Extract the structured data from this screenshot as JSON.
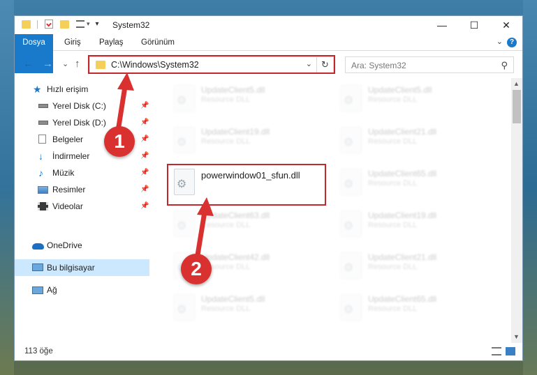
{
  "window": {
    "title": "System32",
    "minimize_glyph": "—",
    "maximize_glyph": "☐",
    "close_glyph": "✕"
  },
  "ribbon": {
    "tabs": [
      "Dosya",
      "Giriş",
      "Paylaş",
      "Görünüm"
    ],
    "help_glyph": "?",
    "collapse_glyph": "⌄"
  },
  "nav": {
    "back_glyph": "←",
    "forward_glyph": "→",
    "recent_glyph": "⌄",
    "up_glyph": "↑",
    "address": "C:\\Windows\\System32",
    "address_dropdown_glyph": "⌄",
    "refresh_glyph": "↻",
    "search_placeholder": "Ara: System32",
    "search_glyph": "⚲"
  },
  "sidebar": {
    "quick_access": "Hızlı erişim",
    "items": [
      {
        "label": "Yerel Disk (C:)",
        "icon": "drive-icon",
        "pinned": true
      },
      {
        "label": "Yerel Disk (D:)",
        "icon": "drive-icon",
        "pinned": true
      },
      {
        "label": "Belgeler",
        "icon": "documents-icon",
        "pinned": true
      },
      {
        "label": "İndirmeler",
        "icon": "downloads-icon",
        "pinned": true
      },
      {
        "label": "Müzik",
        "icon": "music-icon",
        "pinned": true
      },
      {
        "label": "Resimler",
        "icon": "pictures-icon",
        "pinned": true
      },
      {
        "label": "Videolar",
        "icon": "videos-icon",
        "pinned": true
      }
    ],
    "onedrive": "OneDrive",
    "this_pc": "Bu bilgisayar",
    "network": "Ağ",
    "pin_glyph": "📌"
  },
  "files": {
    "left_column": [
      {
        "name": "UpdateClient5.dll",
        "type": "Resource DLL"
      },
      {
        "name": "UpdateClient19.dll",
        "type": "Resource DLL"
      },
      {
        "name": "powerwindow01_sfun.dll",
        "type": ""
      },
      {
        "name": "UpdateClient63.dll",
        "type": "Resource DLL"
      },
      {
        "name": "UpdateClient42.dll",
        "type": "Resource DLL"
      },
      {
        "name": "UpdateClient5.dll",
        "type": "Resource DLL"
      }
    ],
    "right_column": [
      {
        "name": "UpdateClient5.dll",
        "type": "Resource DLL"
      },
      {
        "name": "UpdateClient21.dll",
        "type": "Resource DLL"
      },
      {
        "name": "UpdateClient65.dll",
        "type": "Resource DLL"
      },
      {
        "name": "UpdateClient19.dll",
        "type": "Resource DLL"
      },
      {
        "name": "UpdateClient21.dll",
        "type": "Resource DLL"
      },
      {
        "name": "UpdateClient65.dll",
        "type": "Resource DLL"
      }
    ]
  },
  "scrollbar": {
    "up_glyph": "▲",
    "down_glyph": "▼"
  },
  "status": {
    "count": "113 öğe"
  },
  "annotations": {
    "badge1": "1",
    "badge2": "2",
    "color": "#d8312f"
  },
  "colors": {
    "accent": "#1979ca",
    "highlight_box": "#c3262b",
    "selection": "#cce8ff"
  }
}
